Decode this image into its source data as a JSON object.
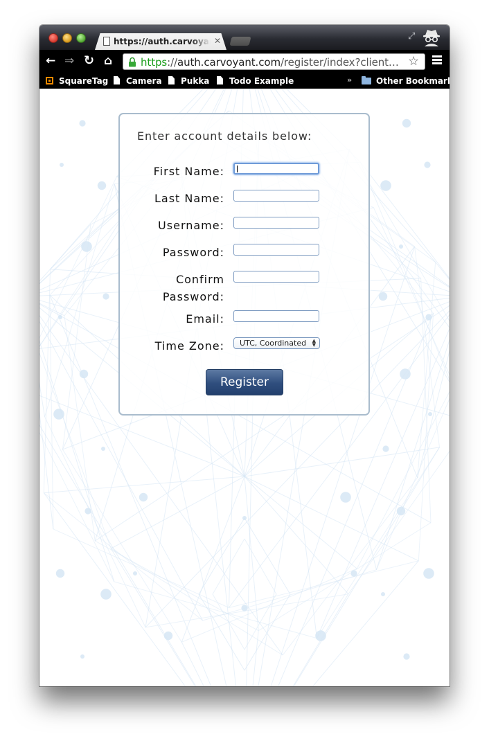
{
  "browser": {
    "tab_title": "https://auth.carvoyant.com",
    "tab_close": "✕",
    "url_scheme": "https",
    "url_sep": "://",
    "url_host": "auth.carvoyant.com",
    "url_rest": "/register/index?client_id=...",
    "nav": {
      "back": "←",
      "forward": "⇒",
      "reload": "↻",
      "home": "⌂"
    },
    "star": "☆",
    "fullscreen": "⤢"
  },
  "bookmarks": {
    "items": [
      {
        "label": "SquareTag",
        "icon": "squaretag-icon"
      },
      {
        "label": "Camera",
        "icon": "page-icon"
      },
      {
        "label": "Pukka",
        "icon": "page-icon"
      },
      {
        "label": "Todo Example",
        "icon": "page-icon"
      }
    ],
    "overflow": "»",
    "other": "Other Bookmarks"
  },
  "form": {
    "intro": "Enter account details below:",
    "fields": [
      {
        "label": "First Name:",
        "value": ""
      },
      {
        "label": "Last Name:",
        "value": ""
      },
      {
        "label": "Username:",
        "value": ""
      },
      {
        "label": "Password:",
        "value": ""
      },
      {
        "label_line1": "Confirm",
        "label_line2": "Password:",
        "value": ""
      },
      {
        "label": "Email:",
        "value": ""
      }
    ],
    "timezone_label": "Time Zone:",
    "timezone_value": "UTC, Coordinated",
    "submit": "Register"
  },
  "colors": {
    "button": "#2f4e7e",
    "card_border": "#a9bccd",
    "secure_green": "#1c9e1c",
    "background_art": "#d6e6f5"
  }
}
